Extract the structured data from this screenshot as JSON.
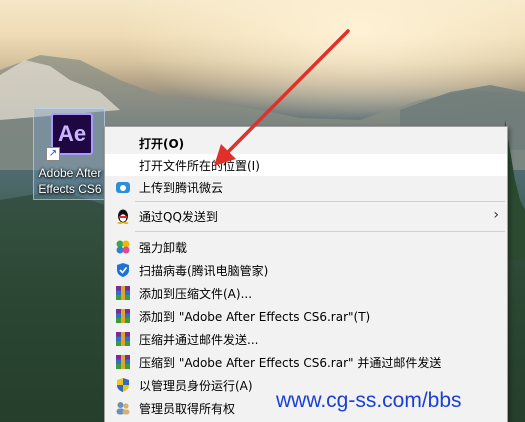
{
  "desktop": {
    "icon": {
      "logo_text": "Ae",
      "label_line1": "Adobe After",
      "label_line2": "Effects CS6"
    }
  },
  "context_menu": {
    "items": [
      {
        "label": "打开(O)",
        "icon": "none"
      },
      {
        "label": "打开文件所在的位置(I)",
        "icon": "none"
      },
      {
        "label": "上传到腾讯微云",
        "icon": "cloud-icon"
      },
      {
        "label": "通过QQ发送到",
        "icon": "qq-penguin-icon"
      },
      {
        "label": "强力卸载",
        "icon": "pinwheel-icon"
      },
      {
        "label": "扫描病毒(腾讯电脑管家)",
        "icon": "shield-icon"
      },
      {
        "label": "添加到压缩文件(A)...",
        "icon": "winrar-icon"
      },
      {
        "label": "添加到 \"Adobe After Effects CS6.rar\"(T)",
        "icon": "winrar-icon"
      },
      {
        "label": "压缩并通过邮件发送...",
        "icon": "winrar-icon"
      },
      {
        "label": "压缩到 \"Adobe After Effects CS6.rar\" 并通过邮件发送",
        "icon": "winrar-icon"
      },
      {
        "label": "以管理员身份运行(A)",
        "icon": "uac-shield-icon"
      },
      {
        "label": "管理员取得所有权",
        "icon": "users-icon"
      }
    ]
  },
  "watermark": "www.cg-ss.com/bbs",
  "colors": {
    "menu_bg": "#f2f2f2",
    "hover_bg": "#ffffff",
    "arrow_red": "#e0302a",
    "watermark_blue": "#1a3fd6"
  }
}
